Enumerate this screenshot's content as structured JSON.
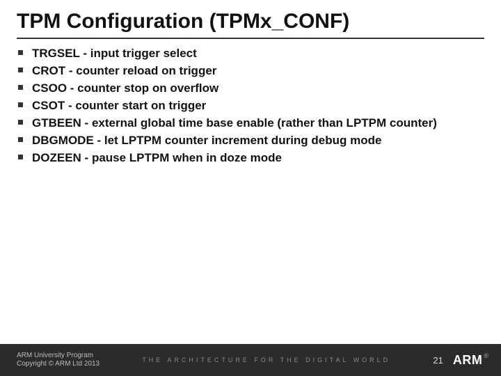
{
  "title": "TPM Configuration (TPMx_CONF)",
  "bullets": [
    "TRGSEL - input trigger select",
    "CROT - counter reload on trigger",
    "CSOO - counter stop on overflow",
    "CSOT - counter start on trigger",
    "GTBEEN - external global time base enable (rather than LPTPM counter)",
    "DBGMODE - let LPTPM counter increment during debug mode",
    "DOZEEN - pause LPTPM when in doze mode"
  ],
  "footer": {
    "line1": "ARM University Program",
    "line2": "Copyright © ARM Ltd 2013",
    "tagline": "THE ARCHITECTURE FOR THE DIGITAL WORLD",
    "page": "21",
    "logo_text": "ARM",
    "logo_reg": "®"
  }
}
